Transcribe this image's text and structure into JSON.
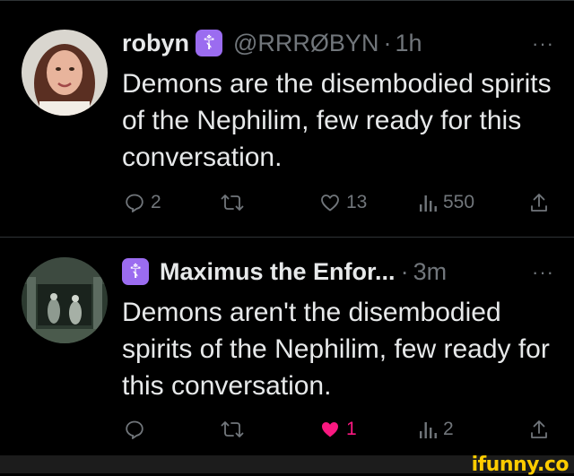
{
  "colors": {
    "background": "#000000",
    "text": "#e7e9ea",
    "muted": "#71767b",
    "badge": "#9b6cf0",
    "like_active": "#f91880",
    "watermark": "#ffcc00"
  },
  "tweets": [
    {
      "name": "robyn",
      "badge_glyph": "☦",
      "handle": "@RRRØBYN",
      "separator": "·",
      "time": "1h",
      "more": "···",
      "text": "Demons are the disembodied spirits of the Nephilim, few ready for this conversation.",
      "actions": {
        "reply": "2",
        "repost": "",
        "like": "13",
        "views": "550"
      },
      "icons": [
        "reply-icon",
        "repost-icon",
        "heart-icon",
        "views-icon",
        "share-icon"
      ]
    },
    {
      "name": "Maximus the Enfor...",
      "badge_glyph": "☦",
      "separator": "·",
      "time": "3m",
      "more": "···",
      "text": "Demons aren't the disembodied spirits of the Nephilim, few ready for this conversation.",
      "actions": {
        "reply": "",
        "repost": "",
        "like": "1",
        "views": "2"
      },
      "icons": [
        "reply-icon",
        "repost-icon",
        "heart-filled-icon",
        "views-icon",
        "share-icon"
      ]
    }
  ],
  "watermark": "ifunny.co"
}
